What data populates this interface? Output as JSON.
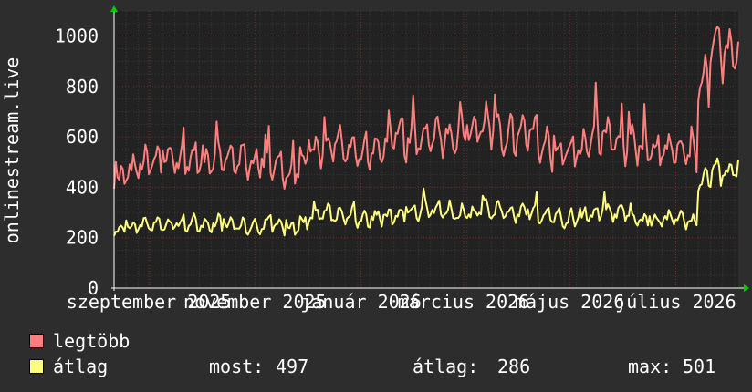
{
  "chart_data": {
    "type": "line",
    "ylabel": "onlinestream.live",
    "ylim": [
      0,
      1100
    ],
    "yticks": [
      0,
      200,
      400,
      600,
      800,
      1000
    ],
    "xticks": [
      {
        "label": "szeptember 2025",
        "x": "2025-09-01"
      },
      {
        "label": "november 2025",
        "x": "2025-11-01"
      },
      {
        "label": "január 2026",
        "x": "2026-01-01"
      },
      {
        "label": "március 2026",
        "x": "2026-03-01"
      },
      {
        "label": "május 2026",
        "x": "2026-05-01"
      },
      {
        "label": "július 2026",
        "x": "2026-07-01"
      }
    ],
    "xlim": [
      "2025-08-12",
      "2026-08-06"
    ],
    "grid": true,
    "series": [
      {
        "name": "legtöbb",
        "color": "#ff7f7f",
        "weekly_values": [
          430,
          470,
          490,
          500,
          520,
          505,
          510,
          505,
          520,
          510,
          515,
          500,
          505,
          490,
          440,
          480,
          540,
          560,
          570,
          560,
          520,
          540,
          570,
          600,
          580,
          600,
          620,
          610,
          600,
          620,
          650,
          620,
          600,
          605,
          610,
          560,
          540,
          540,
          555,
          600,
          610,
          580,
          560,
          550,
          540,
          560,
          540,
          520,
          800,
          940,
          960,
          980,
          1000
        ]
      },
      {
        "name": "átlag",
        "color": "#ffff7f",
        "weekly_values": [
          230,
          250,
          255,
          250,
          255,
          260,
          255,
          250,
          255,
          250,
          250,
          245,
          250,
          245,
          230,
          250,
          290,
          300,
          290,
          280,
          270,
          280,
          285,
          300,
          300,
          305,
          310,
          300,
          290,
          295,
          320,
          310,
          300,
          300,
          290,
          285,
          280,
          275,
          285,
          300,
          310,
          290,
          280,
          270,
          265,
          275,
          270,
          260,
          420,
          460,
          470,
          480,
          490
        ]
      }
    ]
  },
  "legend": {
    "max_label": "legtöbb",
    "avg_label": "átlag",
    "now_label": "most:",
    "now_value": "497",
    "mean_label": "átlag:",
    "mean_value": "286",
    "maxv_label": "max:",
    "maxv_value": "501"
  }
}
